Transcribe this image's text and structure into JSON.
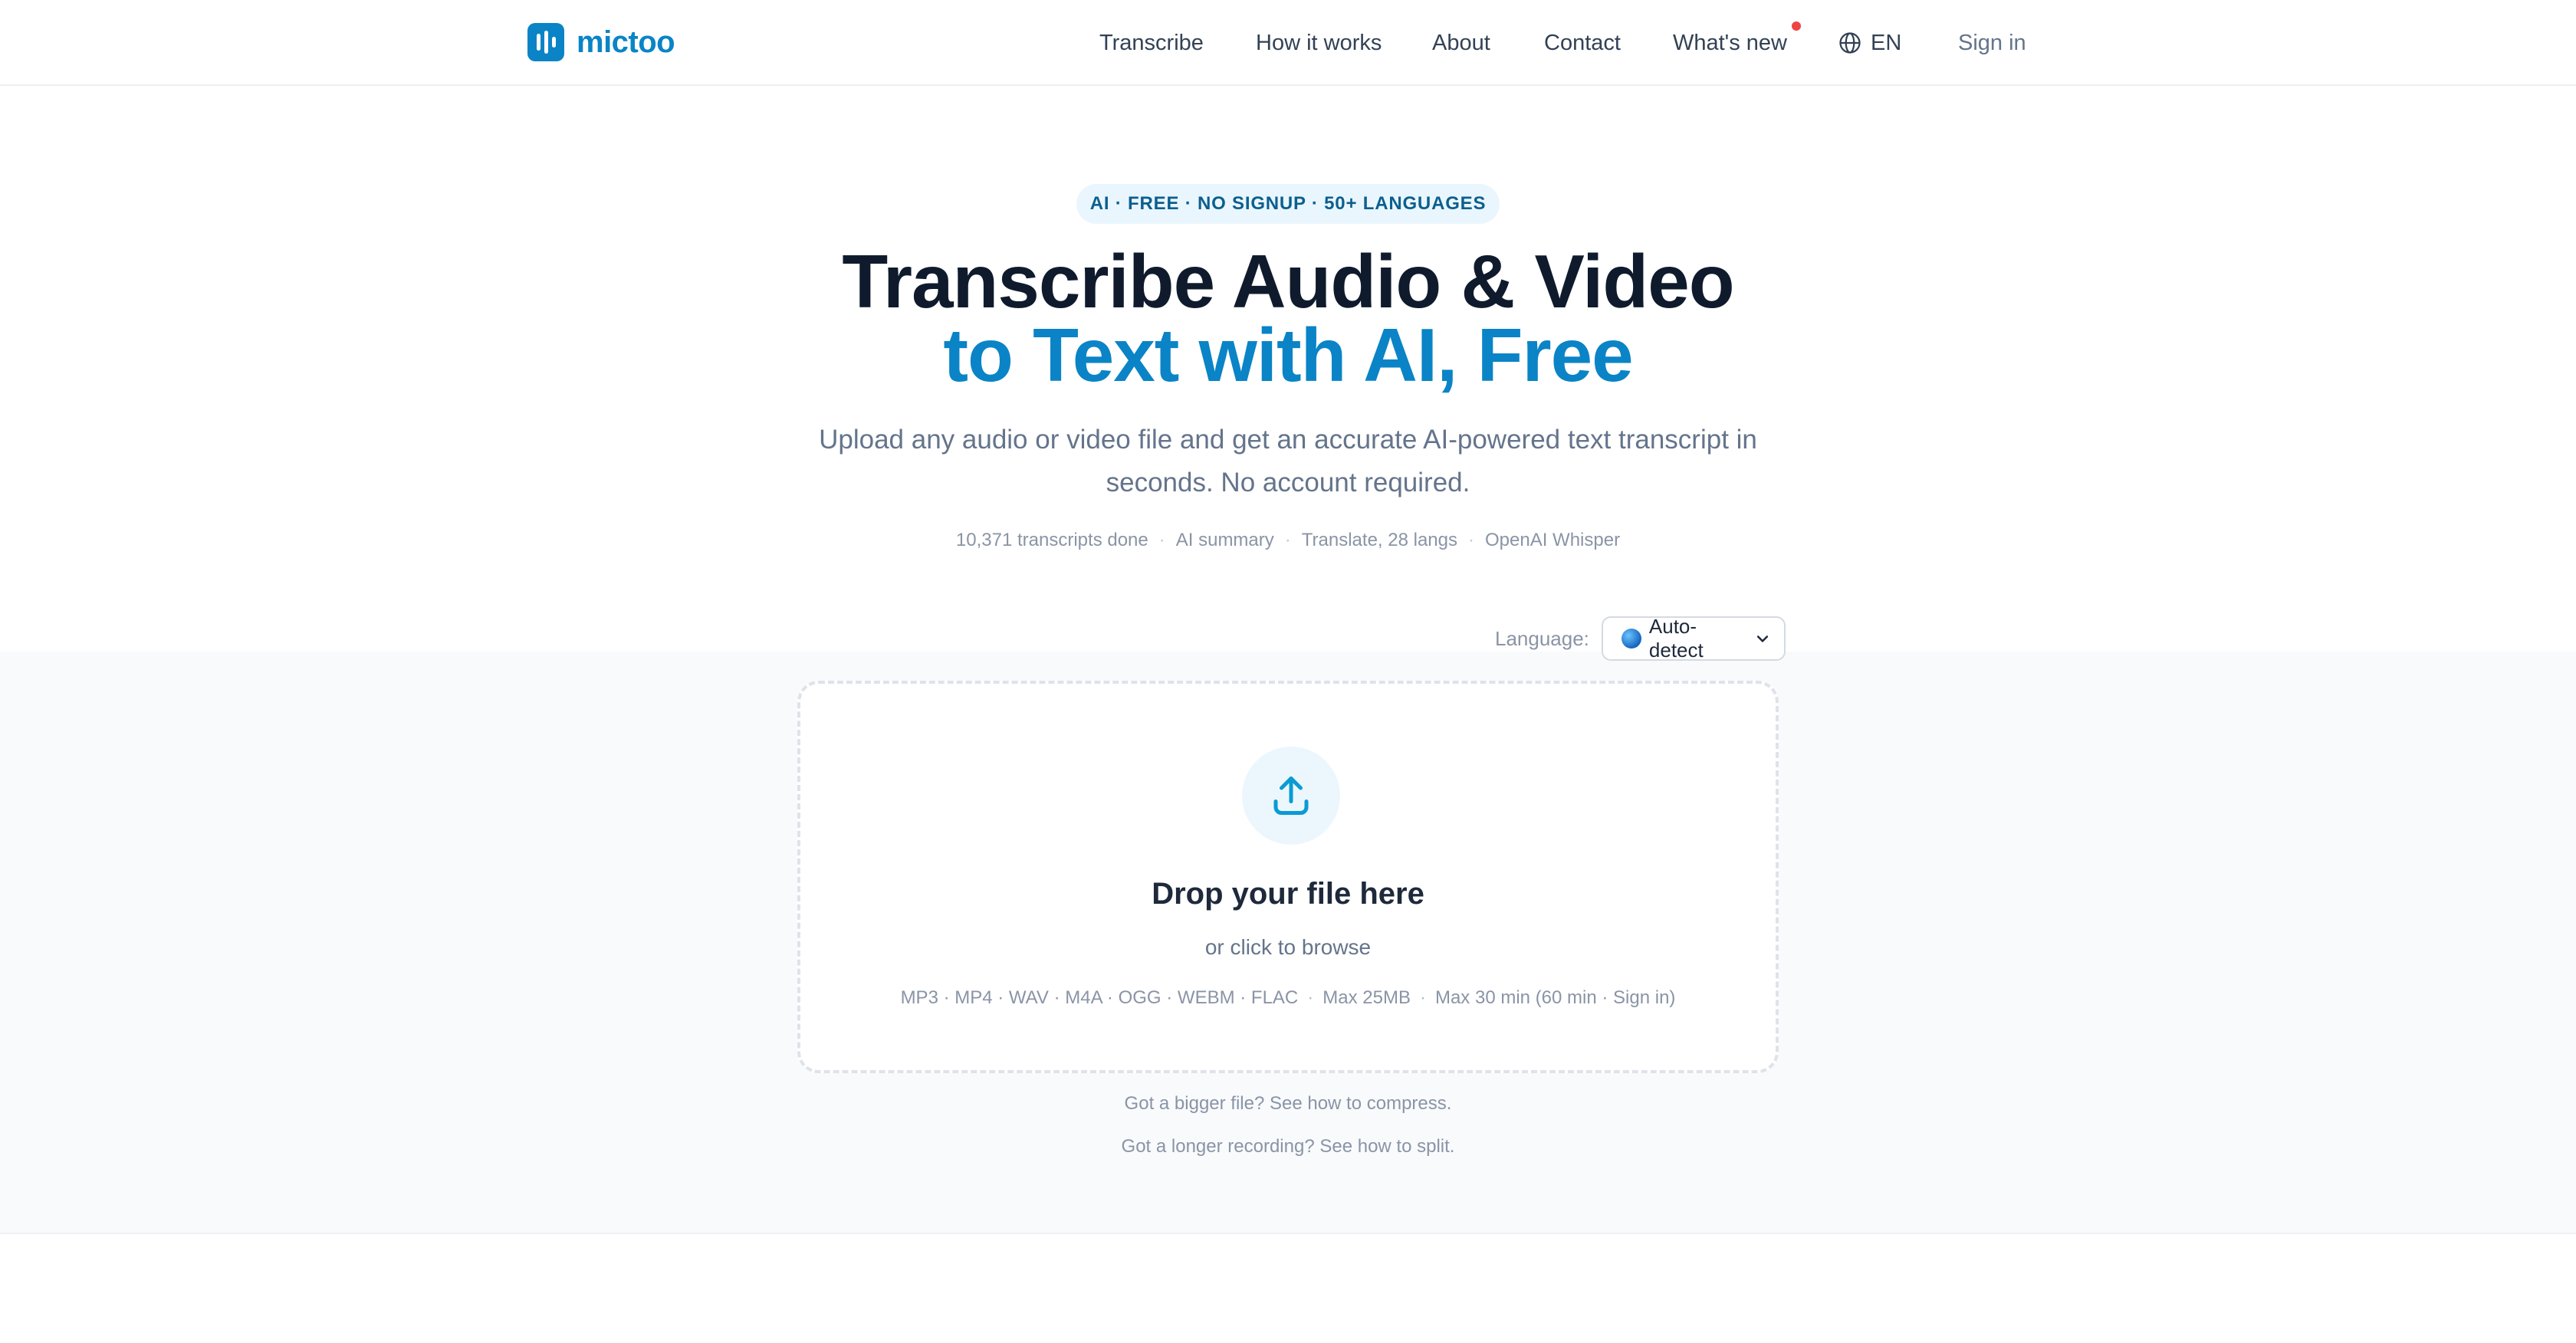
{
  "header": {
    "logo_text": "mictoo",
    "nav": [
      {
        "label": "Transcribe"
      },
      {
        "label": "How it works"
      },
      {
        "label": "About"
      },
      {
        "label": "Contact"
      },
      {
        "label": "What's new",
        "has_notification_dot": true
      }
    ],
    "language_switch": "EN",
    "sign_in": "Sign in"
  },
  "hero": {
    "badge": "AI · FREE · NO SIGNUP · 50+ LANGUAGES",
    "title_line1": "Transcribe Audio & Video",
    "title_line2": "to Text with AI, Free",
    "subtitle": "Upload any audio or video file and get an accurate AI-powered text transcript in seconds. No account required.",
    "stats": [
      "10,371 transcripts done",
      "AI summary",
      "Translate, 28 langs",
      "OpenAI Whisper"
    ],
    "stats_separator": "·"
  },
  "upload": {
    "language_label": "Language:",
    "language_value": "Auto-detect",
    "drop_title": "Drop your file here",
    "drop_subtitle": "or click to browse",
    "formats": "MP3 · MP4 · WAV · M4A · OGG · WEBM · FLAC",
    "max_size": "Max 25MB",
    "max_duration": "Max 30 min (60 min · Sign in)",
    "separator": "·",
    "help_compress": "Got a bigger file? See how to compress.",
    "help_split": "Got a longer recording? See how to split."
  },
  "colors": {
    "accent": "#0a84c6",
    "title": "#0f1b2d",
    "muted": "#64748b",
    "notification": "#ef4444",
    "band_bg": "#f8fafc"
  },
  "icons": {
    "logo": "audio-bars-icon",
    "language": "globe-icon",
    "upload": "upload-icon",
    "select": "chevron-down-icon"
  }
}
